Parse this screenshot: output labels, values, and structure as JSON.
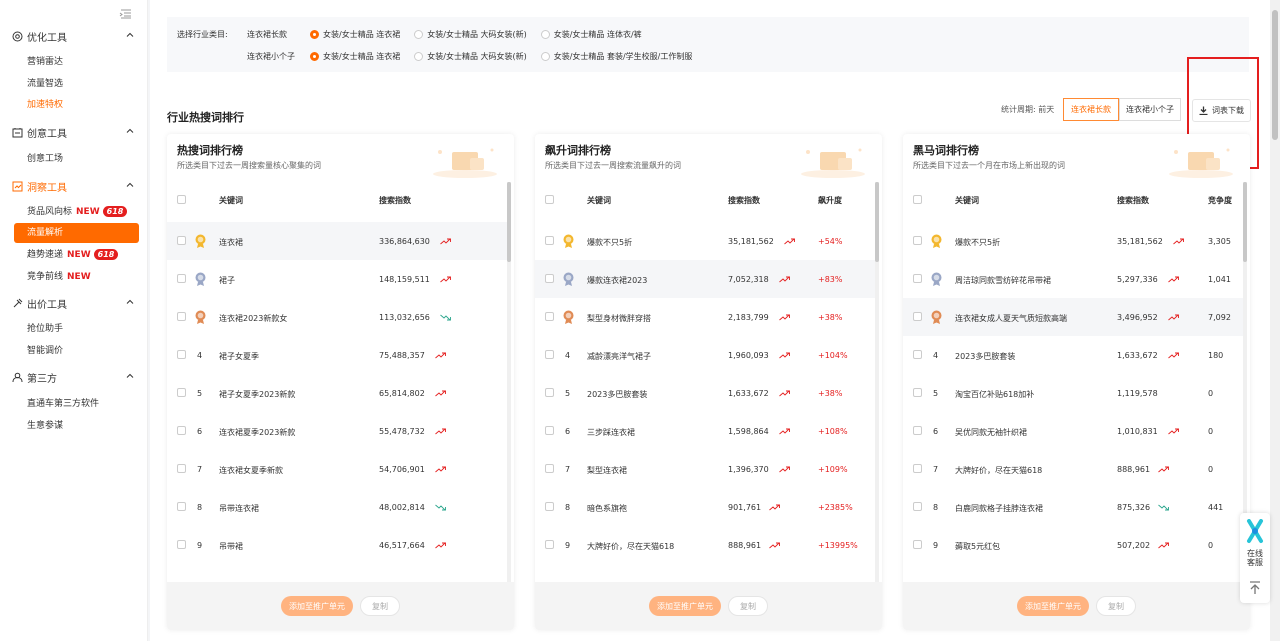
{
  "sidebar": {
    "groups": [
      {
        "label": "优化工具",
        "items": [
          "营销雷达",
          "流量智选",
          "加速特权"
        ]
      },
      {
        "label": "创意工具",
        "items": [
          "创意工场"
        ]
      },
      {
        "label": "洞察工具",
        "items": [
          "货品风向标",
          "流量解析",
          "趋势速递",
          "竞争前线"
        ]
      },
      {
        "label": "出价工具",
        "items": [
          "抢位助手",
          "智能调价"
        ]
      },
      {
        "label": "第三方",
        "items": [
          "直通车第三方软件",
          "生意参谋"
        ]
      }
    ],
    "new_label": "NEW",
    "badge_618": "618"
  },
  "filter": {
    "label": "选择行业类目:",
    "rows": [
      {
        "name": "连衣裙长款",
        "options": [
          "女装/女士精品 连衣裙",
          "女装/女士精品 大码女装(新)",
          "女装/女士精品 连体衣/裤"
        ],
        "selected": 0
      },
      {
        "name": "连衣裙小个子",
        "options": [
          "女装/女士精品 连衣裙",
          "女装/女士精品 大码女装(新)",
          "女装/女士精品 套装/学生校服/工作制服"
        ],
        "selected": 0
      }
    ]
  },
  "section": {
    "title": "行业热搜词排行",
    "period_label": "统计周期: 前天",
    "segments": [
      "连衣裙长款",
      "连衣裙小个子"
    ],
    "download": "词表下载"
  },
  "panels": [
    {
      "title": "热搜词排行榜",
      "subtitle": "所选类目下过去一周搜索量核心聚集的词",
      "columns": [
        "关键词",
        "搜索指数"
      ],
      "rows": [
        {
          "rank": "1",
          "keyword": "连衣裙",
          "index": "336,864,630",
          "trend": "up"
        },
        {
          "rank": "2",
          "keyword": "裙子",
          "index": "148,159,511",
          "trend": "up"
        },
        {
          "rank": "3",
          "keyword": "连衣裙2023新款女",
          "index": "113,032,656",
          "trend": "down"
        },
        {
          "rank": "4",
          "keyword": "裙子女夏季",
          "index": "75,488,357",
          "trend": "up"
        },
        {
          "rank": "5",
          "keyword": "裙子女夏季2023新款",
          "index": "65,814,802",
          "trend": "up"
        },
        {
          "rank": "6",
          "keyword": "连衣裙夏季2023新款",
          "index": "55,478,732",
          "trend": "up"
        },
        {
          "rank": "7",
          "keyword": "连衣裙女夏季新款",
          "index": "54,706,901",
          "trend": "up"
        },
        {
          "rank": "8",
          "keyword": "吊带连衣裙",
          "index": "48,002,814",
          "trend": "down"
        },
        {
          "rank": "9",
          "keyword": "吊带裙",
          "index": "46,517,664",
          "trend": "up"
        }
      ],
      "add_btn": "添加至推广单元",
      "copy_btn": "复制"
    },
    {
      "title": "飙升词排行榜",
      "subtitle": "所选类目下过去一周搜索流量飙升的词",
      "columns": [
        "关键词",
        "搜索指数",
        "飙升度"
      ],
      "rows": [
        {
          "rank": "1",
          "keyword": "爆款不只5折",
          "index": "35,181,562",
          "trend": "up",
          "extra": "+54%"
        },
        {
          "rank": "2",
          "keyword": "爆款连衣裙2023",
          "index": "7,052,318",
          "trend": "up",
          "extra": "+83%"
        },
        {
          "rank": "3",
          "keyword": "梨型身材微胖穿搭",
          "index": "2,183,799",
          "trend": "up",
          "extra": "+38%"
        },
        {
          "rank": "4",
          "keyword": "减龄漂亮洋气裙子",
          "index": "1,960,093",
          "trend": "up",
          "extra": "+104%"
        },
        {
          "rank": "5",
          "keyword": "2023多巴胺套装",
          "index": "1,633,672",
          "trend": "up",
          "extra": "+38%"
        },
        {
          "rank": "6",
          "keyword": "三步踩连衣裙",
          "index": "1,598,864",
          "trend": "up",
          "extra": "+108%"
        },
        {
          "rank": "7",
          "keyword": "梨型连衣裙",
          "index": "1,396,370",
          "trend": "up",
          "extra": "+109%"
        },
        {
          "rank": "8",
          "keyword": "暗色系旗袍",
          "index": "901,761",
          "trend": "up",
          "extra": "+2385%"
        },
        {
          "rank": "9",
          "keyword": "大牌好价，尽在天猫618",
          "index": "888,961",
          "trend": "up",
          "extra": "+13995%"
        }
      ],
      "add_btn": "添加至推广单元",
      "copy_btn": "复制"
    },
    {
      "title": "黑马词排行榜",
      "subtitle": "所选类目下过去一个月在市场上新出现的词",
      "columns": [
        "关键词",
        "搜索指数",
        "竞争度"
      ],
      "rows": [
        {
          "rank": "1",
          "keyword": "爆款不只5折",
          "index": "35,181,562",
          "trend": "up",
          "extra": "3,305"
        },
        {
          "rank": "2",
          "keyword": "周洁琼同款雪纺碎花吊带裙",
          "index": "5,297,336",
          "trend": "up",
          "extra": "1,041"
        },
        {
          "rank": "3",
          "keyword": "连衣裙女成人夏天气质短款高端",
          "index": "3,496,952",
          "trend": "up",
          "extra": "7,092"
        },
        {
          "rank": "4",
          "keyword": "2023多巴胺套装",
          "index": "1,633,672",
          "trend": "up",
          "extra": "180"
        },
        {
          "rank": "5",
          "keyword": "淘宝百亿补贴618加补",
          "index": "1,119,578",
          "trend": "none",
          "extra": "0"
        },
        {
          "rank": "6",
          "keyword": "吴优同款无袖针织裙",
          "index": "1,010,831",
          "trend": "up",
          "extra": "0"
        },
        {
          "rank": "7",
          "keyword": "大牌好价，尽在天猫618",
          "index": "888,961",
          "trend": "up",
          "extra": "0"
        },
        {
          "rank": "8",
          "keyword": "白鹿同款格子挂脖连衣裙",
          "index": "875,326",
          "trend": "down",
          "extra": "441"
        },
        {
          "rank": "9",
          "keyword": "薅取5元红包",
          "index": "507,202",
          "trend": "up",
          "extra": "0"
        }
      ],
      "add_btn": "添加至推广单元",
      "copy_btn": "复制"
    }
  ],
  "service": {
    "line1": "在线",
    "line2": "客服"
  },
  "colors": {
    "accent": "#ff6a00",
    "up": "#e41e1e",
    "down": "#2aa58c"
  }
}
